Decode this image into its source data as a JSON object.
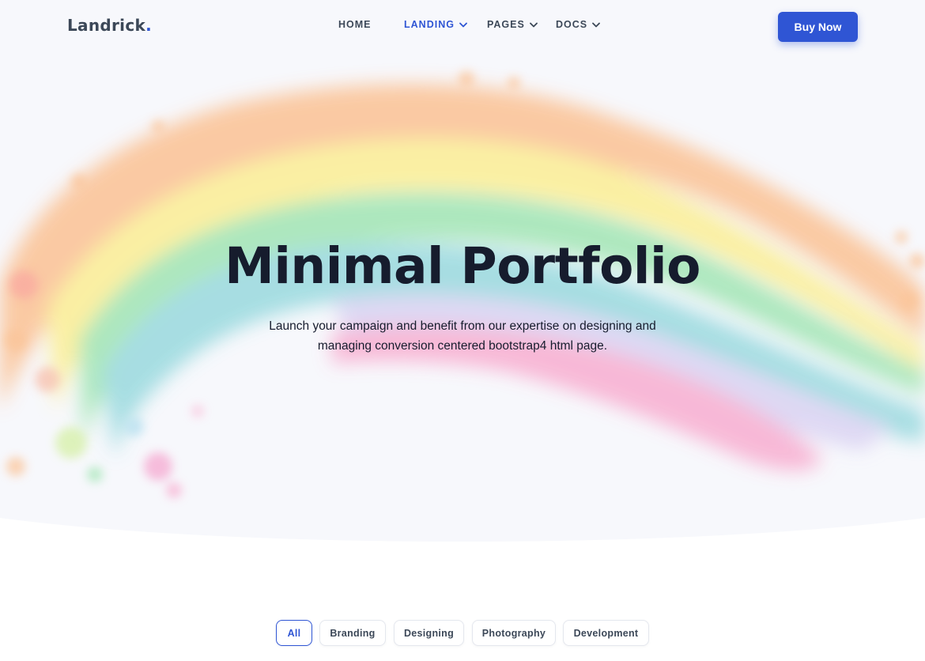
{
  "brand": {
    "name": "Landrick",
    "dot": "."
  },
  "nav": {
    "items": [
      {
        "label": "HOME"
      },
      {
        "label": "LANDING"
      },
      {
        "label": "PAGES"
      },
      {
        "label": "DOCS"
      }
    ],
    "active": "LANDING",
    "cta": "Buy Now"
  },
  "hero": {
    "title": "Minimal Portfolio",
    "subtitle": "Launch your campaign and benefit from our expertise on designing and managing conversion centered bootstrap4 html page."
  },
  "filters": {
    "items": [
      {
        "label": "All"
      },
      {
        "label": "Branding"
      },
      {
        "label": "Designing"
      },
      {
        "label": "Photography"
      },
      {
        "label": "Development"
      }
    ],
    "active": "All"
  },
  "colors": {
    "primary": "#2f55d4",
    "dark": "#161c2d",
    "muted": "#3c4858",
    "hero_bg": "#f7f8fc"
  },
  "icons": {
    "dropdown": "chevron-down-icon"
  }
}
